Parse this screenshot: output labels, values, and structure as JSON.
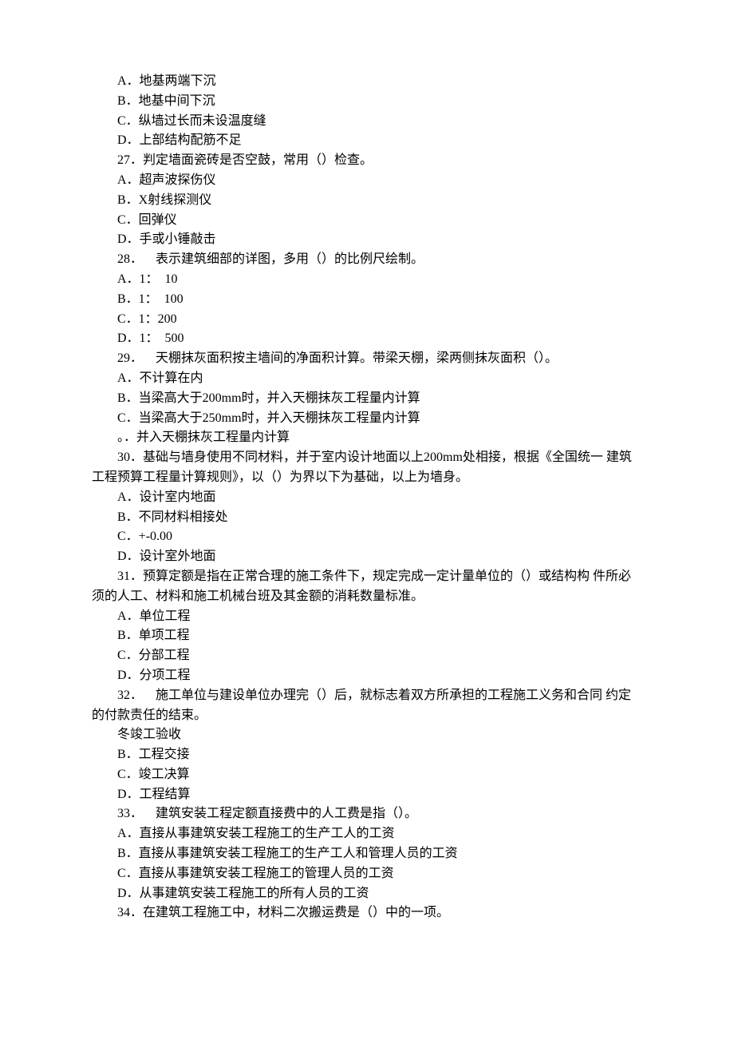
{
  "lines": [
    {
      "cls": "indent-opt",
      "text": "A．地基两端下沉"
    },
    {
      "cls": "indent-opt",
      "text": "B．地基中间下沉"
    },
    {
      "cls": "indent-opt",
      "text": "C．纵墙过长而未设温度缝"
    },
    {
      "cls": "indent-opt",
      "text": "D．上部结构配筋不足"
    },
    {
      "cls": "indent-q",
      "text": "27．判定墙面瓷砖是否空鼓，常用（）检查。"
    },
    {
      "cls": "indent-opt",
      "text": "A．超声波探伤仪"
    },
    {
      "cls": "indent-opt",
      "text": "B．X射线探测仪"
    },
    {
      "cls": "indent-opt",
      "text": "C．回弹仪"
    },
    {
      "cls": "indent-opt",
      "text": "D．手或小锤敲击"
    },
    {
      "cls": "indent-q",
      "text": "28．    表示建筑细部的详图，多用（）的比例尺绘制。"
    },
    {
      "cls": "indent-opt",
      "text": "A．1：  10"
    },
    {
      "cls": "indent-opt",
      "text": "B．1：  100"
    },
    {
      "cls": "indent-opt",
      "text": "C．1：200"
    },
    {
      "cls": "indent-opt",
      "text": "D．1：  500"
    },
    {
      "cls": "indent-q",
      "text": "29．    天棚抹灰面积按主墙间的净面积计算。带梁天棚，梁两侧抹灰面积（）。"
    },
    {
      "cls": "indent-opt",
      "text": "A．不计算在内"
    },
    {
      "cls": "indent-opt",
      "text": "B．当梁高大于200mm时，并入天棚抹灰工程量内计算"
    },
    {
      "cls": "indent-opt",
      "text": "C．当梁高大于250mm时，并入天棚抹灰工程量内计算"
    },
    {
      "cls": "indent-opt",
      "text": "。．并入天棚抹灰工程量内计算"
    },
    {
      "cls": "indent-q",
      "text": "30．基础与墙身使用不同材料，并于室内设计地面以上200mm处相接，根据《全国统一 建筑工程预算工程量计算规则》，以（）为界以下为基础，以上为墙身。"
    },
    {
      "cls": "indent-opt",
      "text": "A．设计室内地面"
    },
    {
      "cls": "indent-opt",
      "text": "B．不同材料相接处"
    },
    {
      "cls": "indent-opt",
      "text": "C．+-0.00"
    },
    {
      "cls": "indent-opt",
      "text": "D．设计室外地面"
    },
    {
      "cls": "indent-q",
      "text": "31．预算定额是指在正常合理的施工条件下，规定完成一定计量单位的（）或结构构 件所必须的人工、材料和施工机械台班及其金额的消耗数量标准。"
    },
    {
      "cls": "indent-opt",
      "text": "A．单位工程"
    },
    {
      "cls": "indent-opt",
      "text": "B．单项工程"
    },
    {
      "cls": "indent-opt",
      "text": "C．分部工程"
    },
    {
      "cls": "indent-opt",
      "text": "D．分项工程"
    },
    {
      "cls": "indent-q",
      "text": "32．    施工单位与建设单位办理完（）后，就标志着双方所承担的工程施工义务和合同 约定的付款责任的结束。"
    },
    {
      "cls": "indent-opt",
      "text": "冬竣工验收"
    },
    {
      "cls": "indent-opt",
      "text": "B．工程交接"
    },
    {
      "cls": "indent-opt",
      "text": "C．竣工决算"
    },
    {
      "cls": "indent-opt",
      "text": "D．工程结算"
    },
    {
      "cls": "indent-q",
      "text": "33．    建筑安装工程定额直接费中的人工费是指（）。"
    },
    {
      "cls": "indent-opt",
      "text": "A．直接从事建筑安装工程施工的生产工人的工资"
    },
    {
      "cls": "indent-opt",
      "text": "B．直接从事建筑安装工程施工的生产工人和管理人员的工资"
    },
    {
      "cls": "indent-opt",
      "text": "C．直接从事建筑安装工程施工的管理人员的工资"
    },
    {
      "cls": "indent-opt",
      "text": "D．从事建筑安装工程施工的所有人员的工资"
    },
    {
      "cls": "indent-q",
      "text": "34．在建筑工程施工中，材料二次搬运费是（）中的一项。"
    }
  ]
}
